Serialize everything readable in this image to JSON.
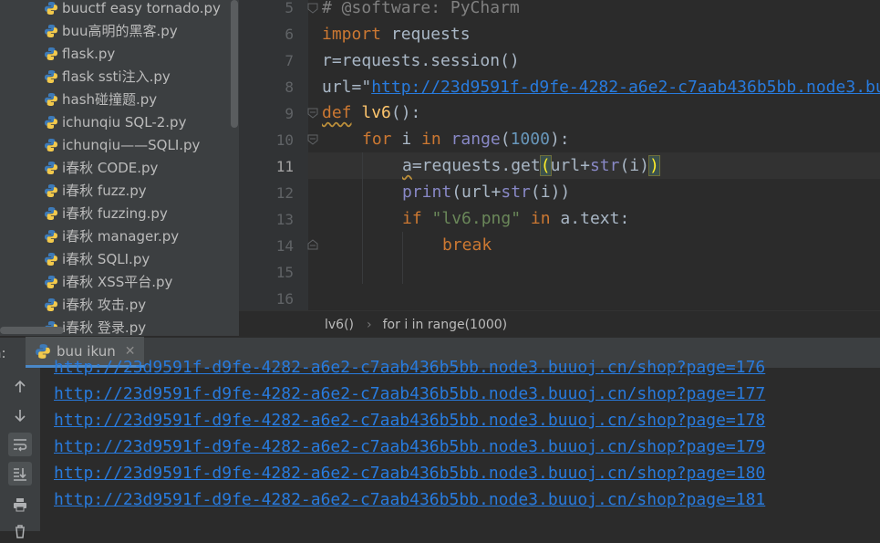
{
  "project_tree": {
    "files": [
      "buuctf easy tornado.py",
      "buu高明的黑客.py",
      "flask.py",
      "flask ssti注入.py",
      "hash碰撞题.py",
      "ichunqiu SQL-2.py",
      "ichunqiu——SQLI.py",
      "i春秋 CODE.py",
      "i春秋 fuzz.py",
      "i春秋 fuzzing.py",
      "i春秋 manager.py",
      "i春秋 SQLI.py",
      "i春秋 XSS平台.py",
      "i春秋 攻击.py",
      "i春秋 登录.py"
    ]
  },
  "editor": {
    "line_numbers": [
      "5",
      "6",
      "7",
      "8",
      "9",
      "10",
      "11",
      "12",
      "13",
      "14",
      "15",
      "16"
    ],
    "current_line": "11",
    "code": {
      "l5": "# @software: PyCharm",
      "l6_kw": "import",
      "l6_rest": " requests",
      "l7": "r=requests.session()",
      "l8_pre": "url=\"",
      "l8_url": "http://23d9591f-d9fe-4282-a6e2-c7aab436b5bb.node3.bu",
      "l9_kw": "def",
      "l9_fn": "lv6",
      "l9_rest": "():",
      "l10_kw1": "for",
      "l10_mid": " i ",
      "l10_kw2": "in",
      "l10_bi": " range",
      "l10_open": "(",
      "l10_num": "1000",
      "l10_close": "):",
      "l11_a": "a",
      "l11_mid": "=requests.get",
      "l11_open": "(",
      "l11_args": "url+",
      "l11_bi": "str",
      "l11_tail": "(i)",
      "l11_close": ")",
      "l12_bi": "print",
      "l12_mid": "(url+",
      "l12_bi2": "str",
      "l12_tail": "(i))",
      "l13_kw": "if",
      "l13_str": " \"lv6.png\" ",
      "l13_kw2": "in",
      "l13_tail": " a.text:",
      "l14_kw": "break"
    }
  },
  "breadcrumb": {
    "items": [
      "lv6()",
      "›",
      "for i in range(1000)"
    ]
  },
  "run_panel": {
    "label": "n:",
    "tab_title": "buu ikun",
    "close_glyph": "✕",
    "output_lines": [
      "http://23d9591f-d9fe-4282-a6e2-c7aab436b5bb.node3.buuoj.cn/shop?page=176",
      "http://23d9591f-d9fe-4282-a6e2-c7aab436b5bb.node3.buuoj.cn/shop?page=177",
      "http://23d9591f-d9fe-4282-a6e2-c7aab436b5bb.node3.buuoj.cn/shop?page=178",
      "http://23d9591f-d9fe-4282-a6e2-c7aab436b5bb.node3.buuoj.cn/shop?page=179",
      "http://23d9591f-d9fe-4282-a6e2-c7aab436b5bb.node3.buuoj.cn/shop?page=180",
      "http://23d9591f-d9fe-4282-a6e2-c7aab436b5bb.node3.buuoj.cn/shop?page=181"
    ],
    "tools": [
      "arrow-up-icon",
      "arrow-down-icon",
      "soft-wrap-icon",
      "scroll-to-end-icon",
      "print-icon",
      "trash-icon"
    ]
  },
  "colors": {
    "tree_bg": "#3c3f41",
    "editor_bg": "#2b2b2b",
    "keyword": "#cc7832",
    "link": "#287bde",
    "number": "#6897bb",
    "string": "#6a8759",
    "function": "#ffc66d"
  }
}
